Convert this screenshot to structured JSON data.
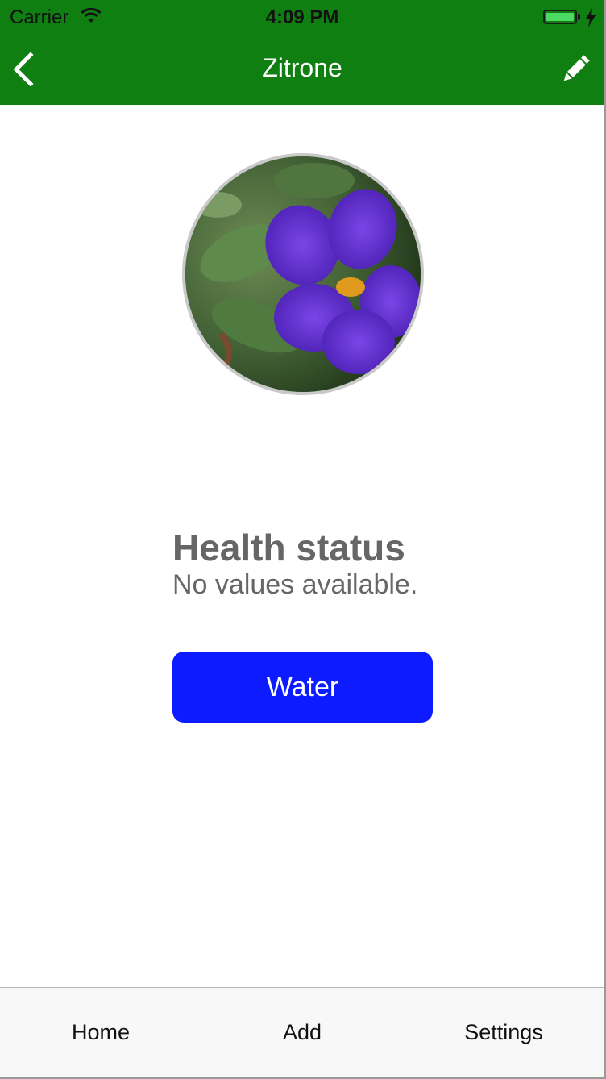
{
  "status_bar": {
    "carrier": "Carrier",
    "time": "4:09 PM",
    "battery_level": 1.0
  },
  "nav_bar": {
    "title": "Zitrone",
    "back_icon": "chevron-left-icon",
    "edit_icon": "pencil-icon",
    "background_color": "#107f12"
  },
  "plant": {
    "photo_description": "purple flower"
  },
  "health": {
    "title": "Health status",
    "value": "No values available."
  },
  "actions": {
    "water_label": "Water",
    "water_color": "#0c1bff"
  },
  "tab_bar": {
    "tabs": [
      {
        "label": "Home"
      },
      {
        "label": "Add"
      },
      {
        "label": "Settings"
      }
    ]
  }
}
